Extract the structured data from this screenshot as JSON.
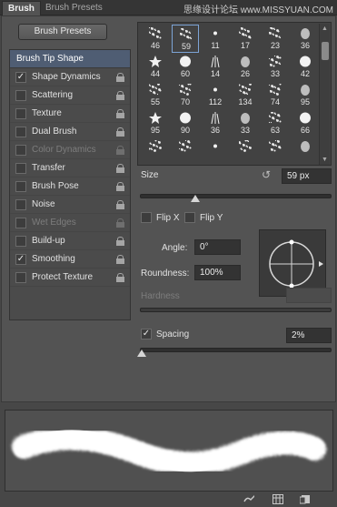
{
  "tabs": [
    {
      "label": "Brush"
    },
    {
      "label": "Brush Presets"
    }
  ],
  "watermark": "思缘设计论坛 www.MISSYUAN.COM",
  "presets_button": "Brush Presets",
  "brush_tip_shape": "Brush Tip Shape",
  "options": [
    {
      "label": "Shape Dynamics",
      "checked": true,
      "disabled": false,
      "lock": true
    },
    {
      "label": "Scattering",
      "checked": false,
      "disabled": false,
      "lock": true
    },
    {
      "label": "Texture",
      "checked": false,
      "disabled": false,
      "lock": true
    },
    {
      "label": "Dual Brush",
      "checked": false,
      "disabled": false,
      "lock": true
    },
    {
      "label": "Color Dynamics",
      "checked": false,
      "disabled": true,
      "lock": true
    },
    {
      "label": "Transfer",
      "checked": false,
      "disabled": false,
      "lock": true
    },
    {
      "label": "Brush Pose",
      "checked": false,
      "disabled": false,
      "lock": true
    },
    {
      "label": "Noise",
      "checked": false,
      "disabled": false,
      "lock": true
    },
    {
      "label": "Wet Edges",
      "checked": false,
      "disabled": true,
      "lock": true
    },
    {
      "label": "Build-up",
      "checked": false,
      "disabled": false,
      "lock": true
    },
    {
      "label": "Smoothing",
      "checked": true,
      "disabled": false,
      "lock": true
    },
    {
      "label": "Protect Texture",
      "checked": false,
      "disabled": false,
      "lock": true
    }
  ],
  "brush_sizes": [
    [
      "46",
      "59",
      "11",
      "17",
      "23",
      "36"
    ],
    [
      "44",
      "60",
      "14",
      "26",
      "33",
      "42"
    ],
    [
      "55",
      "70",
      "112",
      "134",
      "74",
      "95"
    ],
    [
      "95",
      "90",
      "36",
      "33",
      "63",
      "66"
    ],
    [
      "",
      "",
      "",
      "",
      "",
      ""
    ]
  ],
  "selected_brush": "59",
  "size": {
    "label": "Size",
    "value": "59 px"
  },
  "flip_x": {
    "label": "Flip X",
    "checked": false
  },
  "flip_y": {
    "label": "Flip Y",
    "checked": false
  },
  "angle": {
    "label": "Angle:",
    "value": "0°"
  },
  "roundness": {
    "label": "Roundness:",
    "value": "100%"
  },
  "hardness": {
    "label": "Hardness",
    "value": ""
  },
  "spacing": {
    "label": "Spacing",
    "value": "2%",
    "checked": true
  },
  "size_slider_fraction": 0.29,
  "spacing_slider_fraction": 0.01,
  "icons": [
    "reset-size-icon",
    "brush-tool-icon",
    "grid-icon",
    "new-preset-icon"
  ],
  "accent_color": "#4f5d73",
  "selection_color": "#7da4d6"
}
